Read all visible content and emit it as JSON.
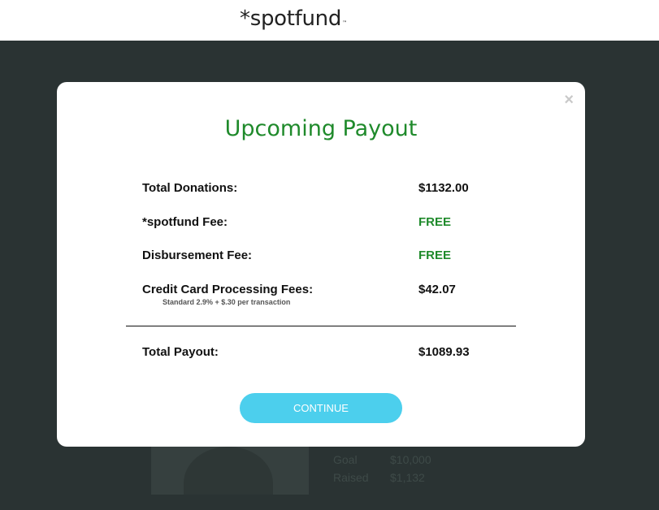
{
  "header": {
    "logo_text": "*spotfund",
    "logo_tm": "™"
  },
  "background": {
    "stats": [
      {
        "label": "Goal",
        "value": "$10,000"
      },
      {
        "label": "Raised",
        "value": "$1,132"
      }
    ]
  },
  "modal": {
    "title": "Upcoming Payout",
    "close_symbol": "×",
    "rows": [
      {
        "label": "Total Donations:",
        "value": "$1132.00"
      },
      {
        "label": "*spotfund Fee:",
        "value": "FREE"
      },
      {
        "label": "Disbursement Fee:",
        "value": "FREE"
      },
      {
        "label": "Credit Card Processing Fees:",
        "value": "$42.07",
        "note": "Standard 2.9% + $.30 per transaction"
      }
    ],
    "total": {
      "label": "Total Payout:",
      "value": "$1089.93"
    },
    "continue_label": "CONTINUE"
  },
  "colors": {
    "accent_green": "#1f8a2b",
    "button_cyan": "#4ccfed",
    "overlay": "#2b3333"
  }
}
